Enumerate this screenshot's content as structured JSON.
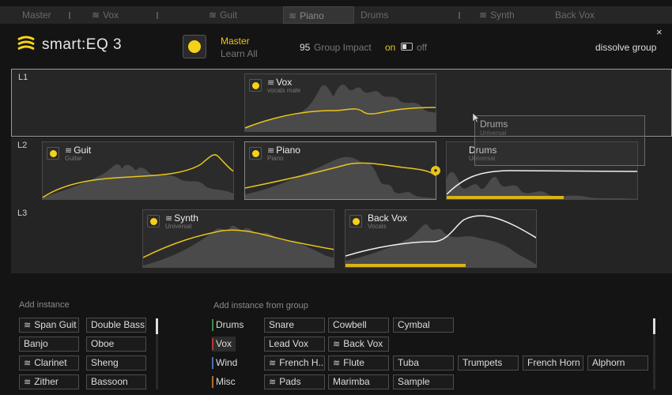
{
  "tabs": [
    {
      "label": "Master",
      "icon": "none"
    },
    {
      "label": "Vox",
      "icon": "smart-eq-icon"
    },
    {
      "label": "Guit",
      "icon": "smart-eq-icon"
    },
    {
      "label": "Piano",
      "icon": "smart-eq-icon",
      "active": true
    },
    {
      "label": "Drums",
      "icon": "none"
    },
    {
      "label": "Synth",
      "icon": "smart-eq-icon"
    },
    {
      "label": "Back Vox",
      "icon": "none"
    }
  ],
  "header": {
    "product": "smart:EQ 3",
    "master_label": "Master",
    "learn_label": "Learn All",
    "group_impact_value": "95",
    "group_impact_label": "Group Impact",
    "on_label": "on",
    "off_label": "off",
    "dissolve_label": "dissolve group",
    "close_glyph": "×"
  },
  "colors": {
    "accent": "#f5d21a",
    "background": "#141414",
    "panel": "#242424"
  },
  "layers": [
    {
      "label": "L1"
    },
    {
      "label": "L2"
    },
    {
      "label": "L3"
    }
  ],
  "cards": {
    "vox": {
      "name": "Vox",
      "sub": "vocals male"
    },
    "guit": {
      "name": "Guit",
      "sub": "Guitar"
    },
    "piano": {
      "name": "Piano",
      "sub": "Piano"
    },
    "drums": {
      "name": "Drums",
      "sub": "Universal"
    },
    "synth": {
      "name": "Synth",
      "sub": "Universal"
    },
    "backvox": {
      "name": "Back Vox",
      "sub": "Vocals"
    }
  },
  "drag_ghost": {
    "name": "Drums",
    "sub": "Universal"
  },
  "add_instance": {
    "title": "Add instance",
    "items": [
      {
        "label": "Span Guit",
        "icon": "smart-eq-icon"
      },
      {
        "label": "Double Bass"
      },
      {
        "label": "Banjo"
      },
      {
        "label": "Oboe"
      },
      {
        "label": "Clarinet",
        "icon": "smart-eq-icon"
      },
      {
        "label": "Sheng"
      },
      {
        "label": "Zither",
        "icon": "smart-eq-icon"
      },
      {
        "label": "Bassoon"
      }
    ]
  },
  "add_from_group": {
    "title": "Add instance from group",
    "rows": [
      {
        "category": "Drums",
        "bar_color": "#3e8a4a",
        "items": [
          {
            "label": "Snare"
          },
          {
            "label": "Cowbell"
          },
          {
            "label": "Cymbal"
          }
        ]
      },
      {
        "category": "Vox",
        "bar_color": "#b03a3a",
        "items": [
          {
            "label": "Lead Vox"
          },
          {
            "label": "Back Vox",
            "icon": "smart-eq-icon"
          }
        ]
      },
      {
        "category": "Wind",
        "bar_color": "#4a6fb0",
        "items": [
          {
            "label": "French H...",
            "icon": "smart-eq-icon"
          },
          {
            "label": "Flute",
            "icon": "smart-eq-icon"
          },
          {
            "label": "Tuba"
          },
          {
            "label": "Trumpets"
          },
          {
            "label": "French Horn"
          },
          {
            "label": "Alphorn"
          }
        ]
      },
      {
        "category": "Misc",
        "bar_color": "#b06a3a",
        "items": [
          {
            "label": "Pads",
            "icon": "smart-eq-icon"
          },
          {
            "label": "Marimba"
          },
          {
            "label": "Sample"
          }
        ]
      }
    ]
  }
}
